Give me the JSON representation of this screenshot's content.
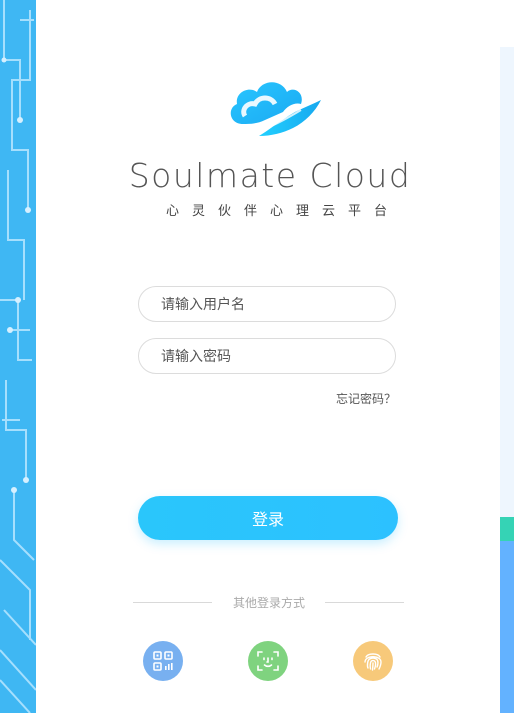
{
  "brand": {
    "title": "Soulmate Cloud",
    "subtitle": "心灵伙伴心理云平台"
  },
  "form": {
    "username_placeholder": "请输入用户名",
    "password_placeholder": "请输入密码",
    "forgot_label": "忘记密码？",
    "login_label": "登录"
  },
  "other_login": {
    "label": "其他登录方式",
    "methods": [
      {
        "icon": "qr-code-icon",
        "color": "#78b0f0"
      },
      {
        "icon": "face-id-icon",
        "color": "#7fd37f"
      },
      {
        "icon": "fingerprint-icon",
        "color": "#f7c97a"
      }
    ]
  },
  "colors": {
    "accent": "#2cc1ff",
    "circuit_bg": "#3fb7f3"
  }
}
